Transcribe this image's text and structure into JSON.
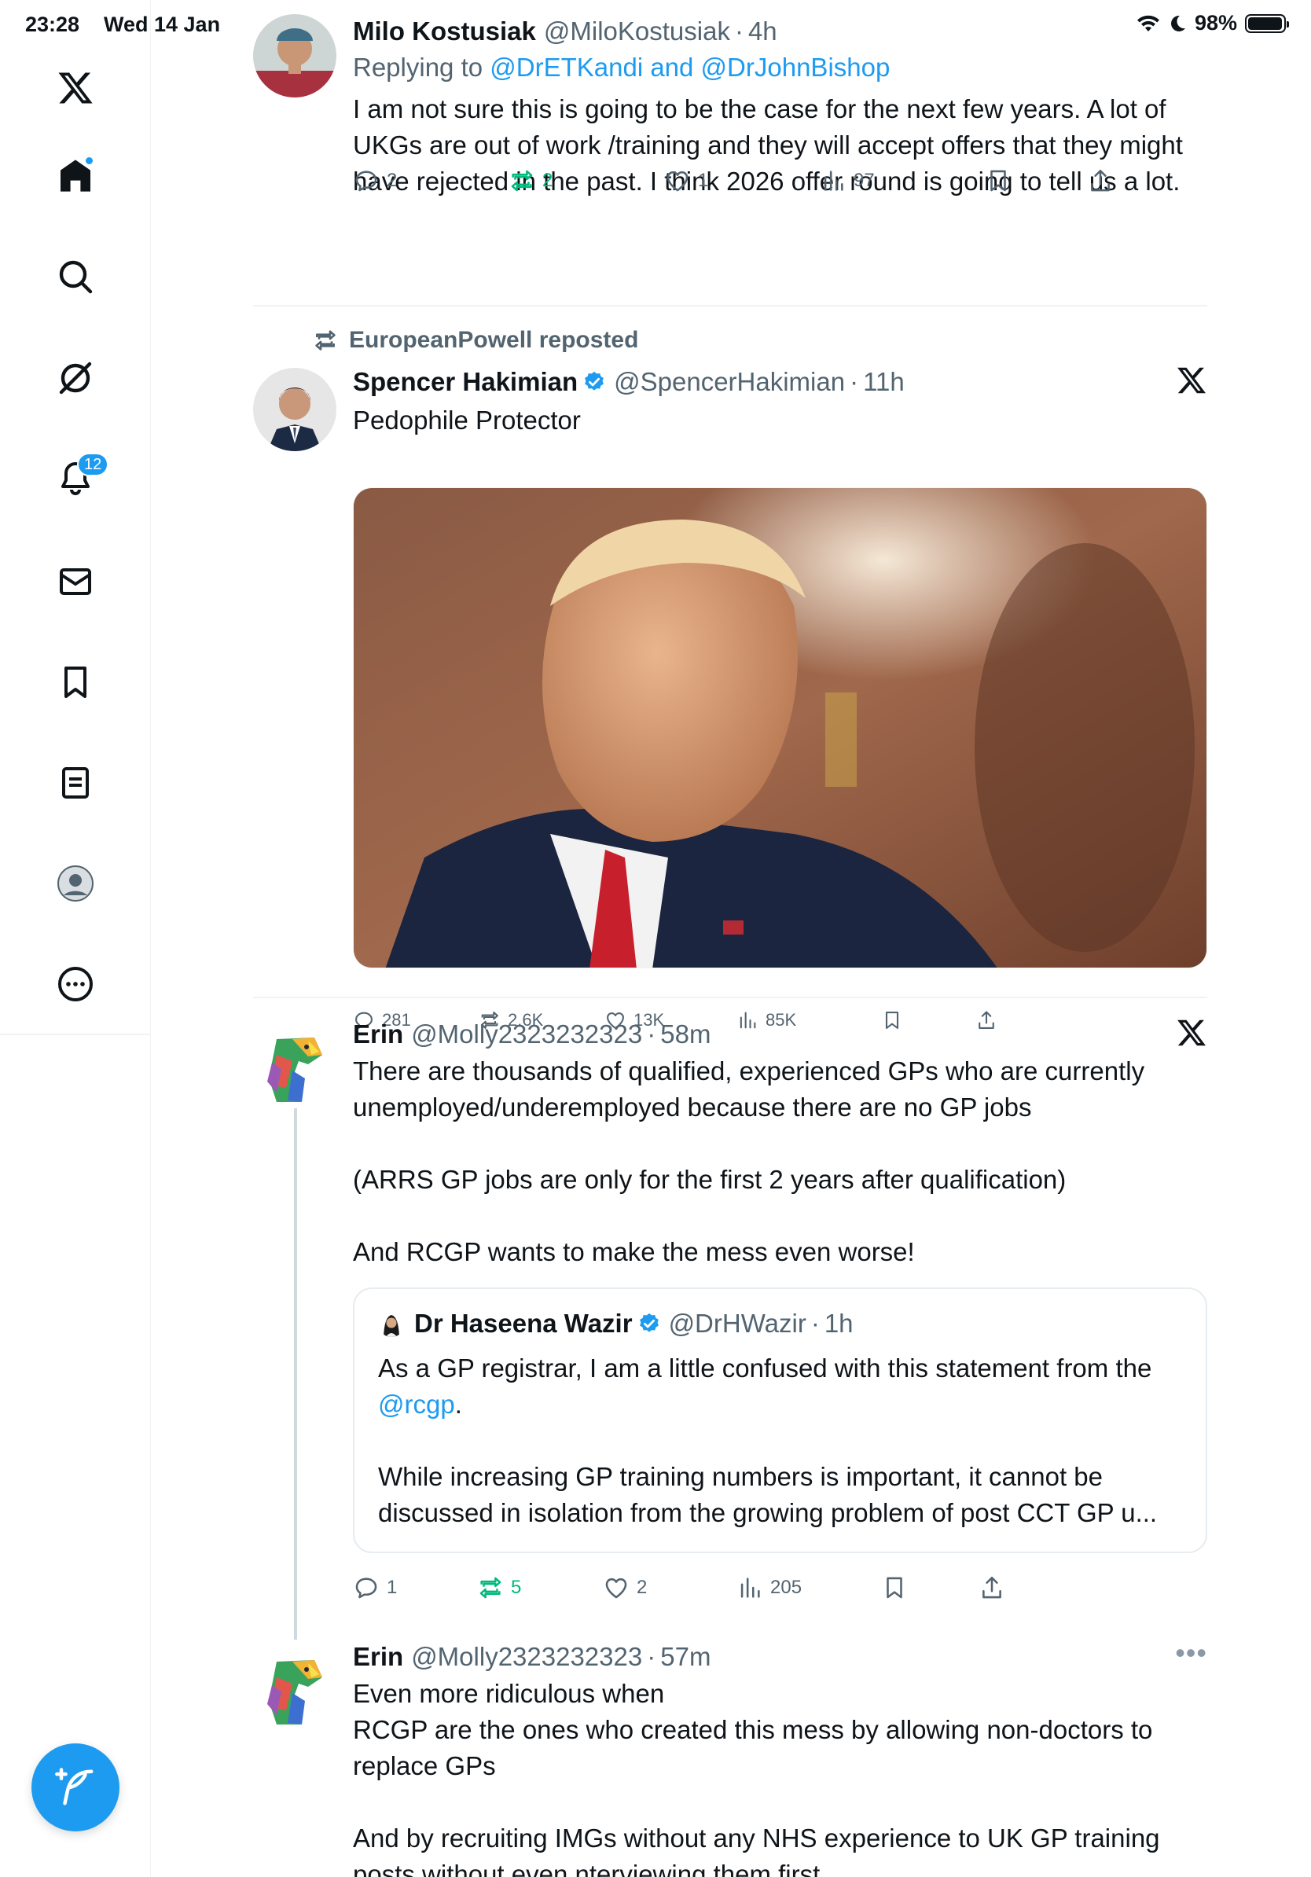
{
  "status_bar": {
    "time": "23:28",
    "date": "Wed 14 Jan",
    "battery": "98%",
    "battery_level": 0.98
  },
  "sidebar": {
    "notification_count": "12",
    "items": [
      "x-logo",
      "home",
      "search",
      "grok",
      "notifications",
      "messages",
      "bookmarks",
      "lists",
      "profile",
      "more"
    ]
  },
  "colors": {
    "accent": "#1d9bf0",
    "text": "#0f1419",
    "secondary": "#536471",
    "repost_active": "#00ba7c",
    "border": "#eff3f4"
  },
  "tweets": [
    {
      "name": "Milo Kostusiak",
      "handle": "@MiloKostusiak",
      "sep": "·",
      "time": "4h",
      "reply_prefix": "Replying to ",
      "reply_to": "@DrETKandi and @DrJohnBishop",
      "text": "I am not sure this is going to be the case for the next few years. A lot of UKGs are out of work /training and they will accept offers that they might have rejected in the past. I think 2026 offer round is going to tell us a lot.",
      "replies": "2",
      "reposts": "2",
      "likes": "1",
      "views": "97"
    },
    {
      "repost_label": "EuropeanPowell reposted",
      "name": "Spencer Hakimian",
      "handle": "@SpencerHakimian",
      "sep": "·",
      "time": "11h",
      "text": "Pedophile Protector",
      "replies": "281",
      "reposts": "2.6K",
      "likes": "13K",
      "views": "85K"
    },
    {
      "name": "Erin",
      "handle": "@Molly2323232323",
      "sep": "·",
      "time": "58m",
      "paragraphs": [
        "There are thousands of qualified, experienced GPs who are currently unemployed/underemployed because there are no GP jobs",
        "(ARRS GP jobs are only for the first 2 years after qualification)",
        "And RCGP wants to make the mess even worse!"
      ],
      "quote": {
        "name": "Dr Haseena Wazir",
        "handle": "@DrHWazir",
        "sep": "·",
        "time": "1h",
        "text_1": "As a GP registrar, I am a little confused with this statement from the ",
        "mention": "@rcgp",
        "text_1_end": ".",
        "text_2": "While increasing GP training numbers is important, it cannot be discussed in isolation from the growing problem of post CCT GP u..."
      },
      "replies": "1",
      "reposts": "5",
      "likes": "2",
      "views": "205"
    },
    {
      "name": "Erin",
      "handle": "@Molly2323232323",
      "sep": "·",
      "time": "57m",
      "lines": [
        "Even more ridiculous when",
        "RCGP are the ones who created this mess by allowing non-doctors to replace GPs"
      ],
      "paragraph_2": "And by recruiting IMGs without any NHS experience to UK GP training posts without even nterviewing them first"
    }
  ]
}
